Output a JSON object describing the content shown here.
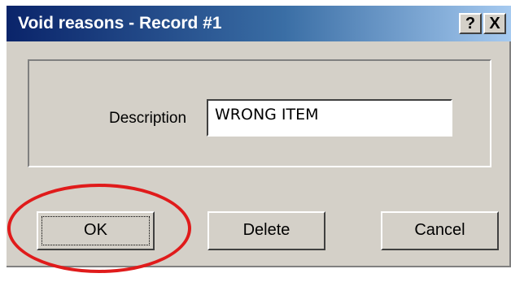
{
  "window": {
    "title": "Void reasons - Record #1",
    "help_label": "?",
    "close_label": "X"
  },
  "form": {
    "description_label": "Description",
    "description_value": "WRONG ITEM"
  },
  "buttons": {
    "ok_label": "OK",
    "delete_label": "Delete",
    "cancel_label": "Cancel"
  },
  "annotation": {
    "highlight_color": "#e01b1b",
    "highlight_target": "ok-button"
  }
}
